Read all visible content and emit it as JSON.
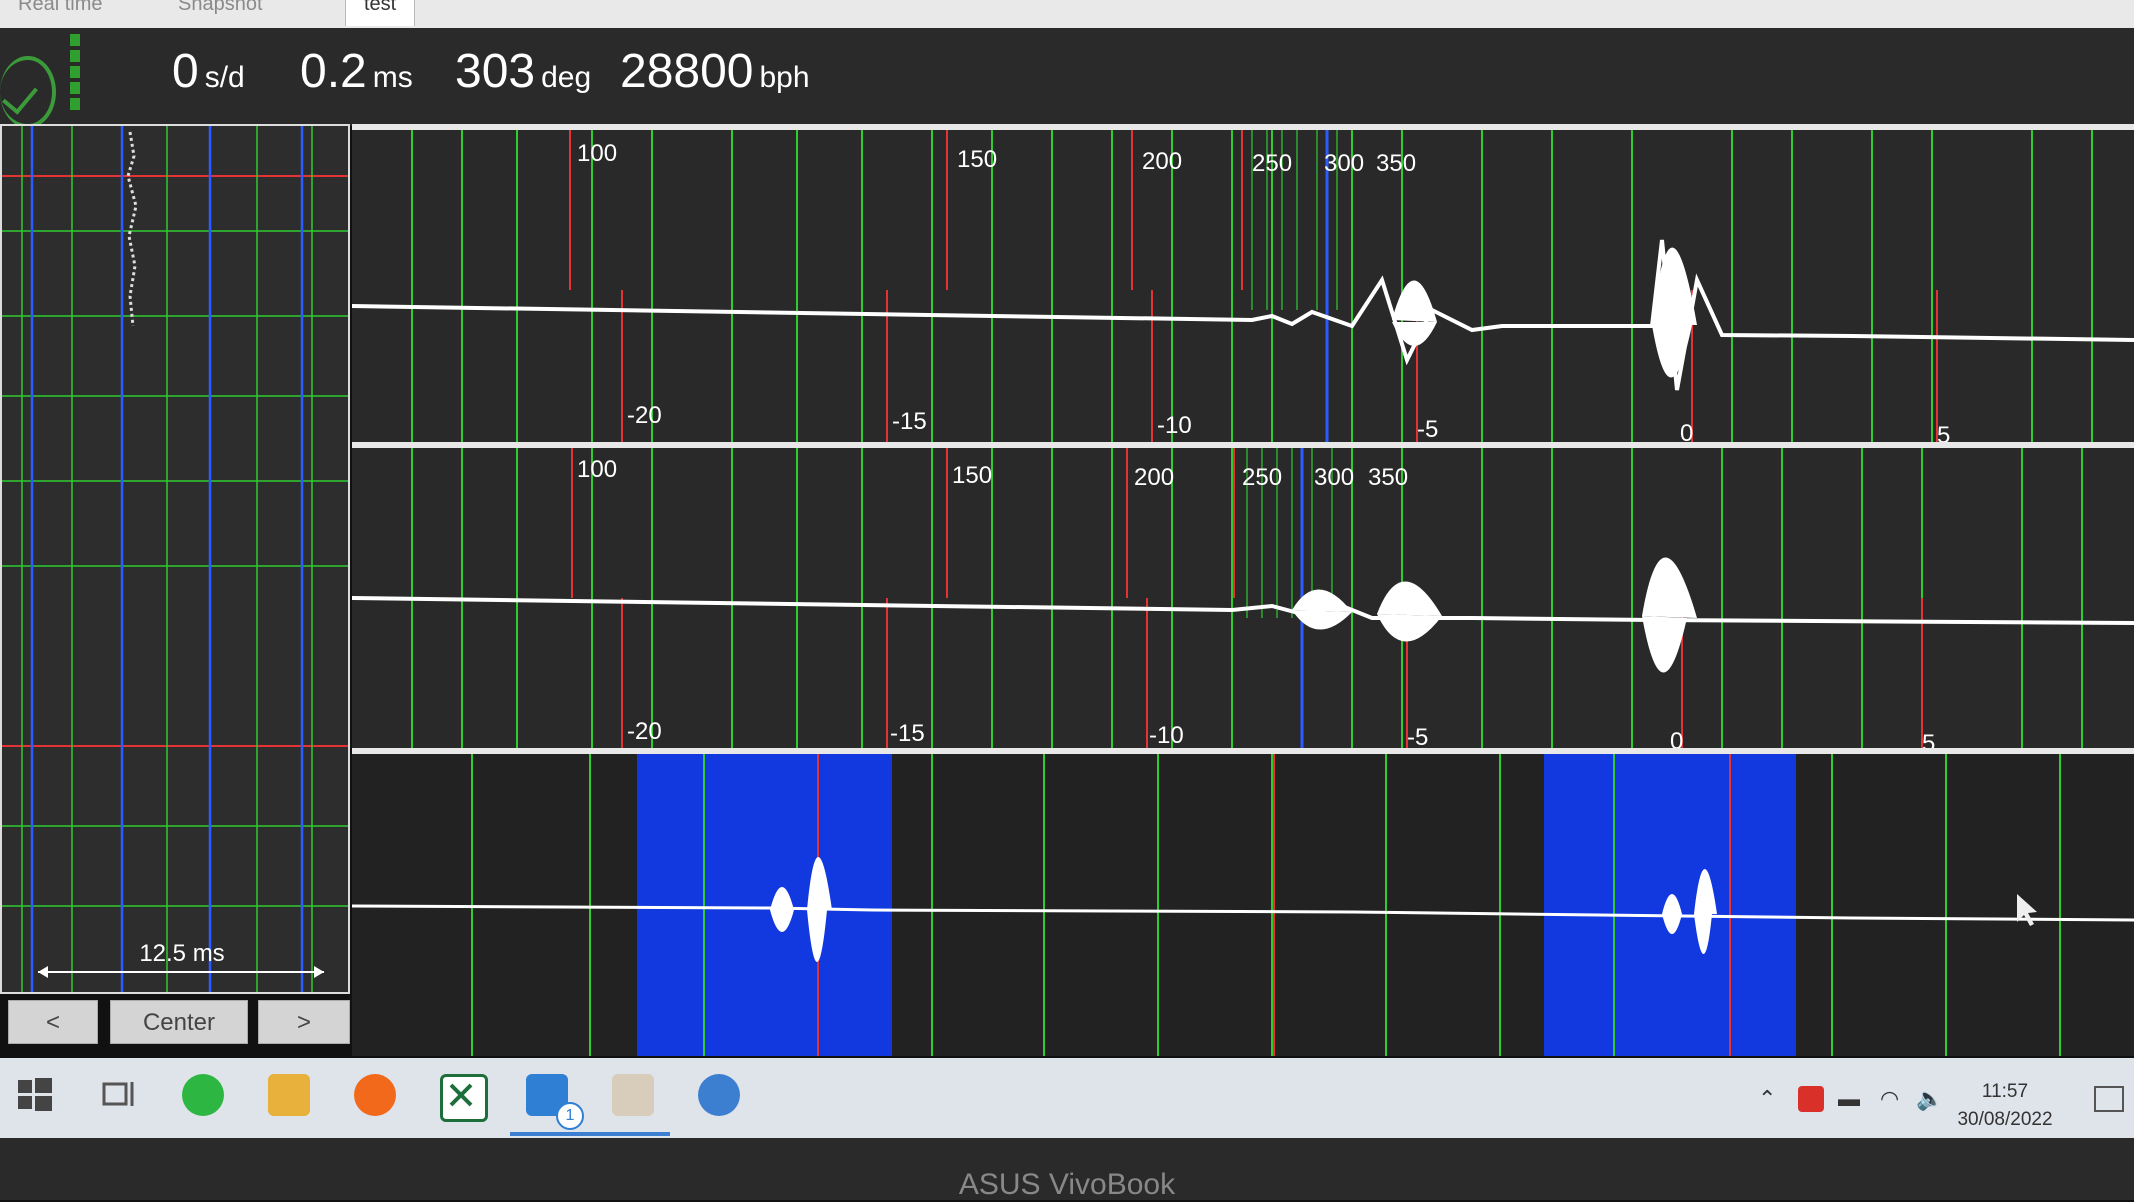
{
  "tabs": [
    "Real time",
    "Snapshot",
    "test"
  ],
  "readouts": [
    {
      "value": "0",
      "unit": "s/d"
    },
    {
      "value": "0.2",
      "unit": "ms"
    },
    {
      "value": "303",
      "unit": "deg"
    },
    {
      "value": "28800",
      "unit": "bph"
    }
  ],
  "left_panel": {
    "scale_label": "12.5 ms"
  },
  "buttons": {
    "prev": "<",
    "center": "Center",
    "next": ">"
  },
  "trace_top": {
    "deg_labels": [
      "100",
      "150",
      "200",
      "250",
      "300",
      "350"
    ],
    "ms_labels": [
      "-20",
      "-15",
      "-10",
      "-5",
      "0",
      "5"
    ]
  },
  "trace_mid": {
    "deg_labels": [
      "100",
      "150",
      "200",
      "250",
      "300",
      "350"
    ],
    "ms_labels": [
      "-20",
      "-15",
      "-10",
      "-5",
      "0",
      "5"
    ]
  },
  "taskbar": {
    "badge": "1"
  },
  "clock": {
    "time": "11:57",
    "date": "30/08/2022"
  },
  "bezel_brand": "ASUS VivoBook",
  "colors": {
    "grid_green": "#2ecc2e",
    "grid_red": "#e33333",
    "marker_blue": "#2a5cff",
    "highlight_blue": "#1238e0",
    "waveform": "#ffffff"
  }
}
